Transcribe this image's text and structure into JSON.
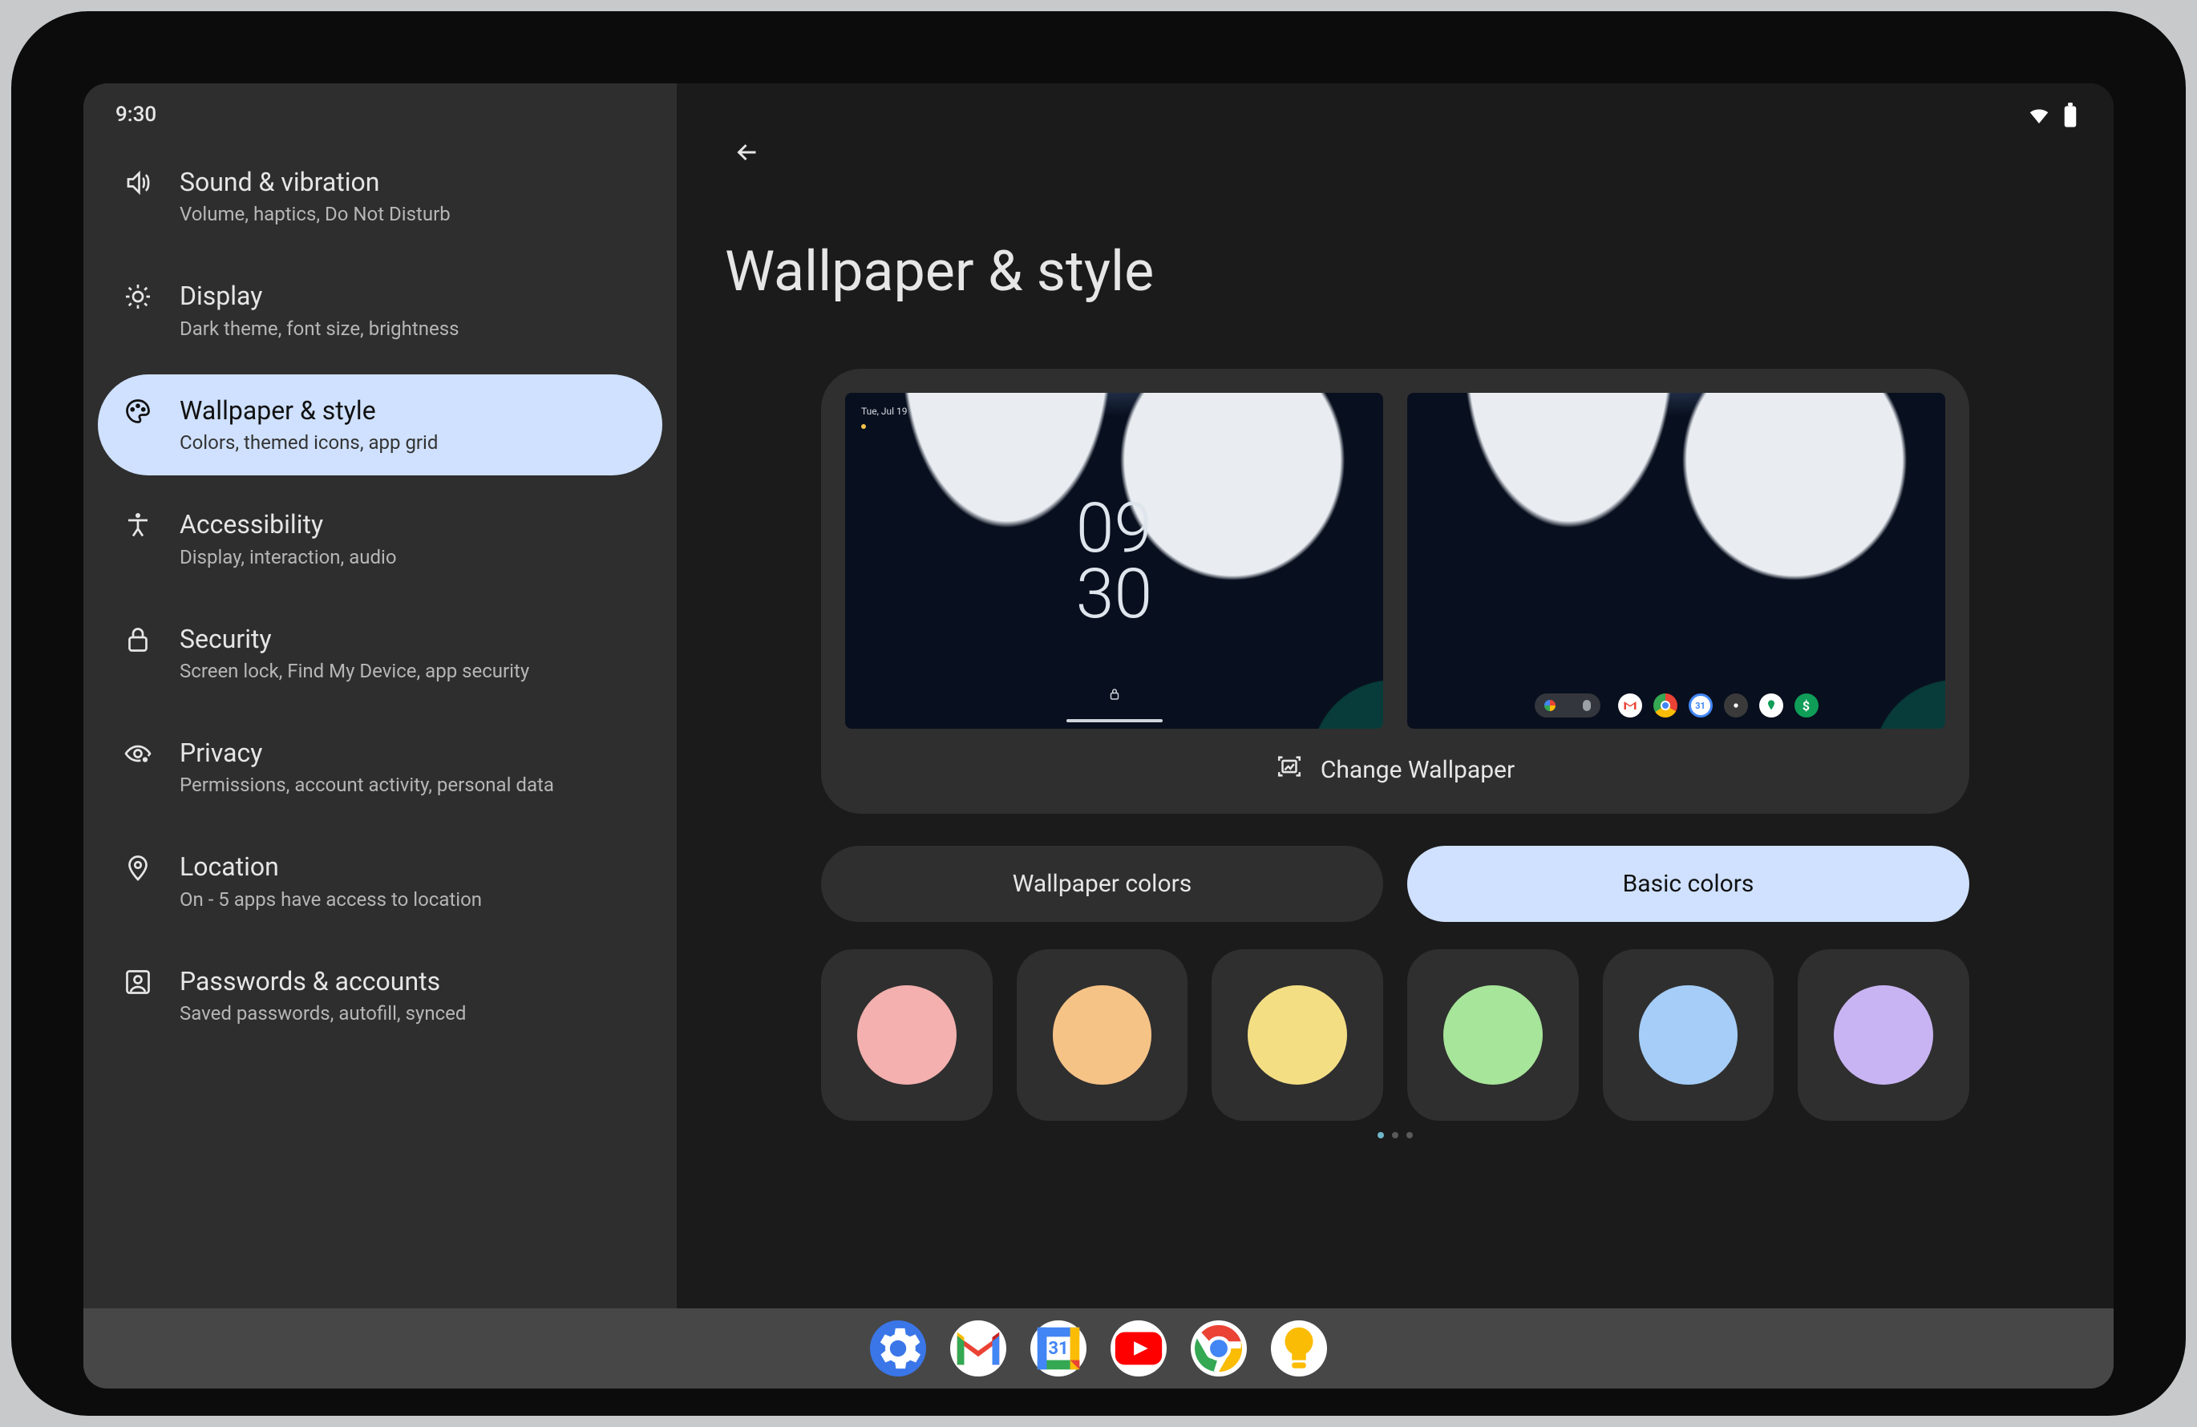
{
  "status": {
    "time": "9:30"
  },
  "sidebar": {
    "items": [
      {
        "title": "Sound & vibration",
        "sub": "Volume, haptics, Do Not Disturb"
      },
      {
        "title": "Display",
        "sub": "Dark theme, font size, brightness"
      },
      {
        "title": "Wallpaper & style",
        "sub": "Colors, themed icons, app grid"
      },
      {
        "title": "Accessibility",
        "sub": "Display, interaction, audio"
      },
      {
        "title": "Security",
        "sub": "Screen lock, Find My Device, app security"
      },
      {
        "title": "Privacy",
        "sub": "Permissions, account activity, personal data"
      },
      {
        "title": "Location",
        "sub": "On - 5 apps have access to location"
      },
      {
        "title": "Passwords & accounts",
        "sub": "Saved passwords, autofill, synced"
      }
    ],
    "selected_index": 2
  },
  "main": {
    "title": "Wallpaper & style",
    "change_label": "Change Wallpaper",
    "lock_preview": {
      "date": "Tue, Jul 19",
      "clock_top": "09",
      "clock_bottom": "30"
    },
    "tabs": {
      "a": "Wallpaper colors",
      "b": "Basic colors",
      "active": "b"
    },
    "colors": [
      "#f3b0ae",
      "#f6c387",
      "#f4de84",
      "#a7e59a",
      "#a5cdf7",
      "#c8b4f3"
    ],
    "pager_active": 0
  },
  "taskbar": {
    "apps": [
      "settings",
      "gmail",
      "calendar",
      "youtube",
      "chrome",
      "keep"
    ],
    "calendar_day": "31"
  }
}
